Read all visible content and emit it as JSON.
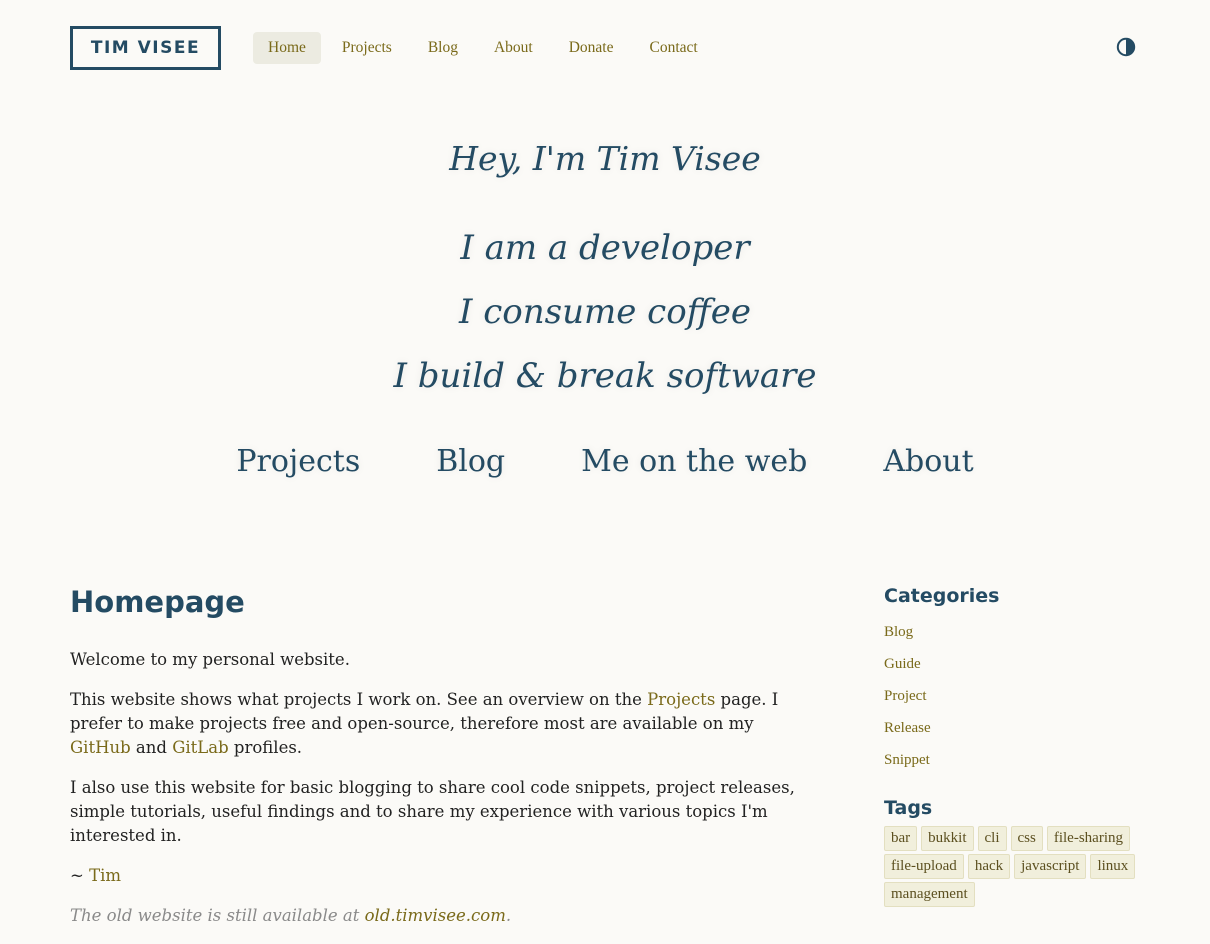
{
  "header": {
    "logo": "TIM VISEE",
    "nav": [
      {
        "label": "Home",
        "active": true
      },
      {
        "label": "Projects"
      },
      {
        "label": "Blog"
      },
      {
        "label": "About"
      },
      {
        "label": "Donate"
      },
      {
        "label": "Contact"
      }
    ],
    "theme_toggle_icon": "contrast-icon"
  },
  "hero": {
    "title": "Hey, I'm Tim Visee",
    "lines": [
      "I am a developer",
      "I consume coffee",
      "I build & break software"
    ]
  },
  "big_nav": [
    "Projects",
    "Blog",
    "Me on the web",
    "About"
  ],
  "main": {
    "heading": "Homepage",
    "p1": "Welcome to my personal website.",
    "p2_a": "This website shows what projects I work on. See an overview on the ",
    "p2_link1": "Projects",
    "p2_b": " page. I prefer to make projects free and open-source, therefore most are available on my ",
    "p2_link2": "GitHub",
    "p2_c": " and ",
    "p2_link3": "GitLab",
    "p2_d": " profiles.",
    "p3": "I also use this website for basic blogging to share cool code snippets, project releases, simple tutorials, useful findings and to share my experience with various topics I'm interested in.",
    "sign_prefix": "~ ",
    "sign_link": "Tim",
    "old_prefix": "The old website is still available at ",
    "old_link": "old.timvisee.com",
    "old_suffix": "."
  },
  "sidebar": {
    "categories_title": "Categories",
    "categories": [
      "Blog",
      "Guide",
      "Project",
      "Release",
      "Snippet"
    ],
    "tags_title": "Tags",
    "tags": [
      "bar",
      "bukkit",
      "cli",
      "css",
      "file-sharing",
      "file-upload",
      "hack",
      "javascript",
      "linux",
      "management"
    ]
  },
  "colors": {
    "accent": "#244b63",
    "link": "#7a6a1a",
    "background": "#fbfaf7"
  }
}
